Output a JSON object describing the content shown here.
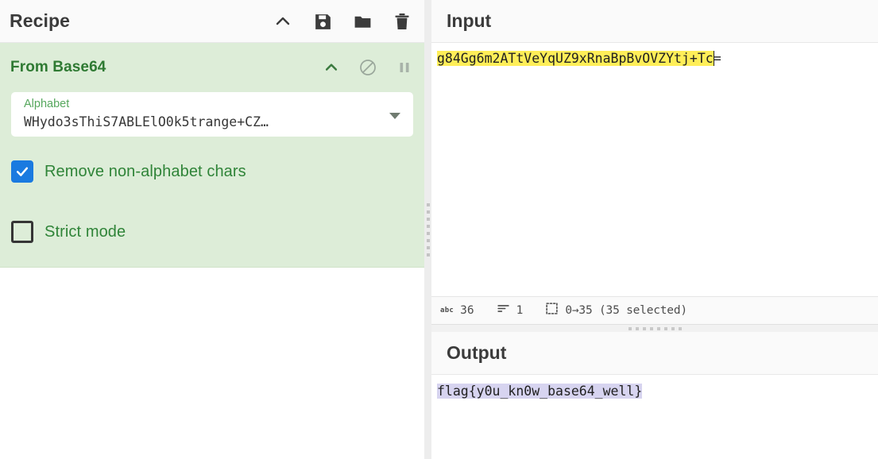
{
  "recipe": {
    "title": "Recipe",
    "icons": [
      {
        "name": "chevron-up-icon",
        "label": "Collapse"
      },
      {
        "name": "save-icon",
        "label": "Save recipe"
      },
      {
        "name": "folder-icon",
        "label": "Load recipe"
      },
      {
        "name": "trash-icon",
        "label": "Clear recipe"
      }
    ],
    "operation": {
      "name": "From Base64",
      "header_icons": [
        {
          "name": "chevron-up-icon",
          "label": "Hide arguments"
        },
        {
          "name": "disable-icon",
          "label": "Disable operation"
        },
        {
          "name": "pause-icon",
          "label": "Set breakpoint"
        }
      ],
      "args": {
        "alphabet": {
          "label": "Alphabet",
          "value": "WHydo3sThiS7ABLElO0k5trange+CZ…"
        },
        "checkboxes": [
          {
            "label": "Remove non-alphabet chars",
            "checked": true
          },
          {
            "label": "Strict mode",
            "checked": false
          }
        ]
      }
    }
  },
  "input": {
    "title": "Input",
    "highlighted_text": "g84Gg6m2ATtVeYqUZ9xRnaBpBvOVZYtj+Tc",
    "trailing_text": "=",
    "status": {
      "length_icon": "abc",
      "length": "36",
      "lines_icon": "lines-icon",
      "lines": "1",
      "selection_icon": "selection-icon",
      "selection": "0→35 (35 selected)"
    }
  },
  "output": {
    "title": "Output",
    "text": "flag{y0u_kn0w_base64_well}"
  },
  "colors": {
    "operation_bg": "#ddedd8",
    "operation_title": "#2f7a33",
    "checkbox_accent": "#1a7ae0",
    "input_highlight": "#ffee58",
    "output_highlight": "#d7d4f0"
  }
}
